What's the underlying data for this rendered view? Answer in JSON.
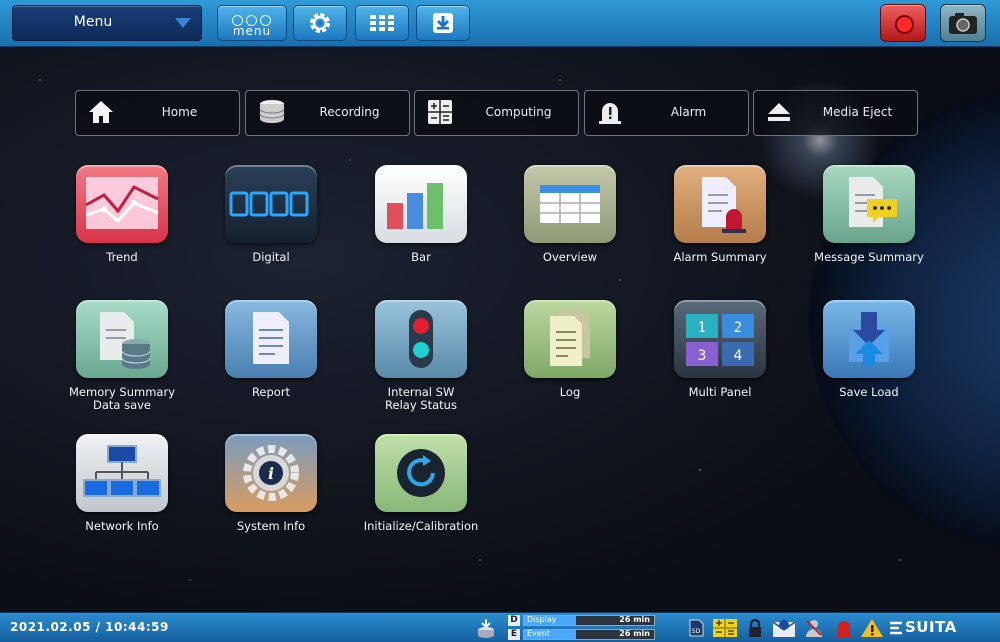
{
  "topbar": {
    "menu_dropdown": "Menu",
    "menu_button": "menu"
  },
  "quickbar": [
    {
      "label": "Home",
      "icon": "home-icon"
    },
    {
      "label": "Recording",
      "icon": "database-icon"
    },
    {
      "label": "Computing",
      "icon": "calculator-icon"
    },
    {
      "label": "Alarm",
      "icon": "alarm-icon"
    },
    {
      "label": "Media Eject",
      "icon": "eject-icon"
    }
  ],
  "apps": [
    {
      "label": "Trend",
      "icon": "trend-chart-icon"
    },
    {
      "label": "Digital",
      "icon": "digital-display-icon"
    },
    {
      "label": "Bar",
      "icon": "bar-chart-icon"
    },
    {
      "label": "Overview",
      "icon": "table-icon"
    },
    {
      "label": "Alarm Summary",
      "icon": "alarm-document-icon"
    },
    {
      "label": "Message Summary",
      "icon": "message-document-icon"
    },
    {
      "label": "Memory Summary\nData save",
      "icon": "memory-database-icon"
    },
    {
      "label": "Report",
      "icon": "report-document-icon"
    },
    {
      "label": "Internal SW\nRelay Status",
      "icon": "relay-light-icon"
    },
    {
      "label": "Log",
      "icon": "log-document-icon"
    },
    {
      "label": "Multi Panel",
      "icon": "multi-panel-icon"
    },
    {
      "label": "Save Load",
      "icon": "save-load-icon"
    },
    {
      "label": "Network Info",
      "icon": "network-icon"
    },
    {
      "label": "System Info",
      "icon": "info-gear-icon"
    },
    {
      "label": "Initialize/Calibration",
      "icon": "refresh-icon"
    }
  ],
  "status": {
    "datetime": "2021.02.05 / 10:44:59",
    "display": {
      "tag": "D",
      "label": "Display",
      "value": "26 min",
      "fill_percent": 40
    },
    "event": {
      "tag": "E",
      "label": "Event",
      "value": "26 min",
      "fill_percent": 40
    },
    "brand": "SUITA"
  },
  "colors": {
    "topbar": "#2f9ad6",
    "statusbar": "#2b8dd0",
    "record": "#d02020"
  }
}
